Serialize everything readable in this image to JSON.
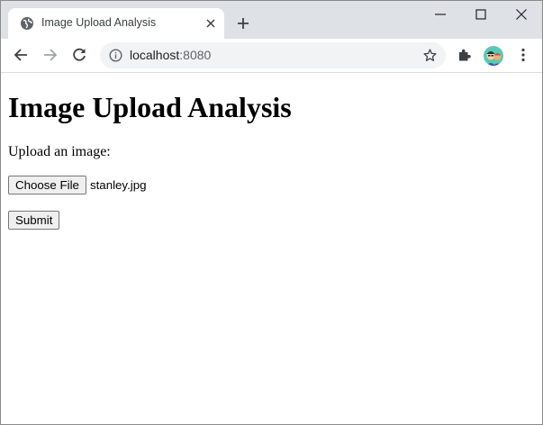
{
  "browser": {
    "tab": {
      "title": "Image Upload Analysis"
    },
    "address": {
      "host": "localhost",
      "port": ":8080"
    }
  },
  "page": {
    "heading": "Image Upload Analysis",
    "upload_label": "Upload an image:",
    "file_input": {
      "button_label": "Choose File",
      "selected_file": "stanley.jpg"
    },
    "submit_label": "Submit"
  },
  "icons": {
    "favicon": "globe-icon",
    "tab_close": "close-icon",
    "new_tab": "plus-icon",
    "minimize": "minimize-icon",
    "maximize": "maximize-icon",
    "close_window": "close-icon",
    "back": "arrow-left-icon",
    "forward": "arrow-right-icon",
    "reload": "reload-icon",
    "site_info": "info-icon",
    "bookmark": "star-icon",
    "extensions": "puzzle-icon",
    "profile": "avatar",
    "menu": "kebab-menu-icon"
  },
  "colors": {
    "tabstrip": "#dee1e6",
    "omnibox": "#f1f3f4",
    "avatar_bg": "#58c9b9"
  }
}
